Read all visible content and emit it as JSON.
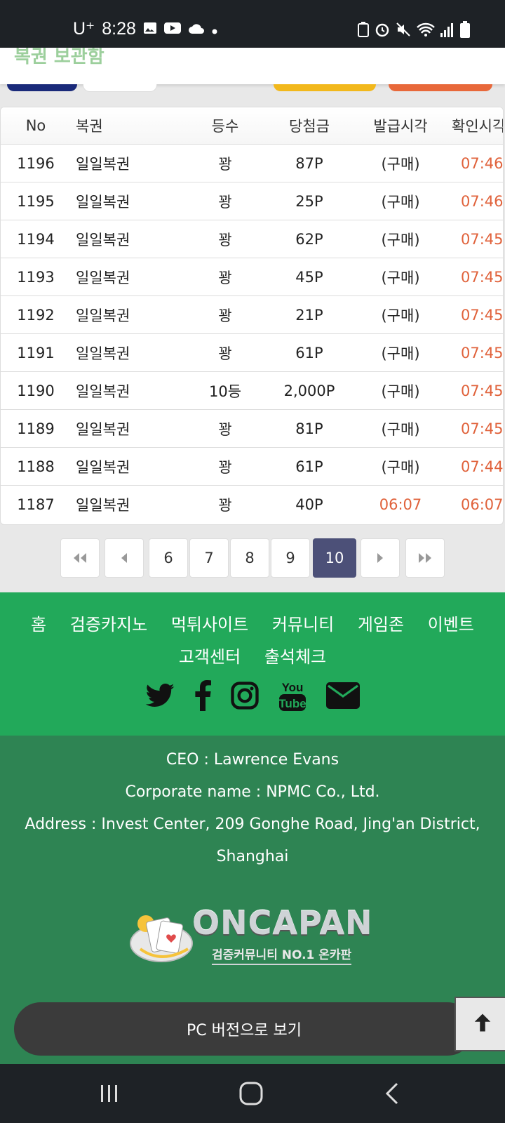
{
  "status_bar": {
    "carrier": "U⁺",
    "time": "8:28"
  },
  "top_card": {
    "title": "복권 보관함"
  },
  "table": {
    "headers": [
      "No",
      "복권",
      "등수",
      "당첨금",
      "발급시각",
      "확인시각"
    ],
    "rows": [
      {
        "no": "1196",
        "name": "일일복권",
        "rank": "꽝",
        "prize": "87P",
        "issued": "(구매)",
        "checked": "07:46"
      },
      {
        "no": "1195",
        "name": "일일복권",
        "rank": "꽝",
        "prize": "25P",
        "issued": "(구매)",
        "checked": "07:46"
      },
      {
        "no": "1194",
        "name": "일일복권",
        "rank": "꽝",
        "prize": "62P",
        "issued": "(구매)",
        "checked": "07:45"
      },
      {
        "no": "1193",
        "name": "일일복권",
        "rank": "꽝",
        "prize": "45P",
        "issued": "(구매)",
        "checked": "07:45"
      },
      {
        "no": "1192",
        "name": "일일복권",
        "rank": "꽝",
        "prize": "21P",
        "issued": "(구매)",
        "checked": "07:45"
      },
      {
        "no": "1191",
        "name": "일일복권",
        "rank": "꽝",
        "prize": "61P",
        "issued": "(구매)",
        "checked": "07:45"
      },
      {
        "no": "1190",
        "name": "일일복권",
        "rank": "10등",
        "prize": "2,000P",
        "issued": "(구매)",
        "checked": "07:45"
      },
      {
        "no": "1189",
        "name": "일일복권",
        "rank": "꽝",
        "prize": "81P",
        "issued": "(구매)",
        "checked": "07:45"
      },
      {
        "no": "1188",
        "name": "일일복권",
        "rank": "꽝",
        "prize": "61P",
        "issued": "(구매)",
        "checked": "07:44"
      },
      {
        "no": "1187",
        "name": "일일복권",
        "rank": "꽝",
        "prize": "40P",
        "issued": "06:07",
        "checked": "06:07"
      }
    ]
  },
  "pagination": {
    "pages": [
      "6",
      "7",
      "8",
      "9",
      "10"
    ],
    "current": "10"
  },
  "footer_nav": {
    "row1": [
      "홈",
      "검증카지노",
      "먹튀사이트",
      "커뮤니티",
      "게임존",
      "이벤트"
    ],
    "row2": [
      "고객센터",
      "출석체크"
    ],
    "social": [
      "twitter-icon",
      "facebook-icon",
      "instagram-icon",
      "youtube-icon",
      "email-icon"
    ]
  },
  "footer_info": {
    "ceo": "CEO : Lawrence Evans",
    "corporate": "Corporate name : NPMC Co., Ltd.",
    "address_line1": "Address : Invest Center, 209 Gonghe Road, Jing'an District,",
    "address_line2": "Shanghai",
    "logo_text": "ONCAPAN",
    "logo_sub": "검증커뮤니티 NO.1 온카판"
  },
  "pc_button": "PC 버전으로 보기",
  "colors": {
    "accent_green": "#22a95a",
    "footer_green": "#2e8453",
    "active_page": "#4c5078",
    "time_orange": "#e0623b"
  }
}
